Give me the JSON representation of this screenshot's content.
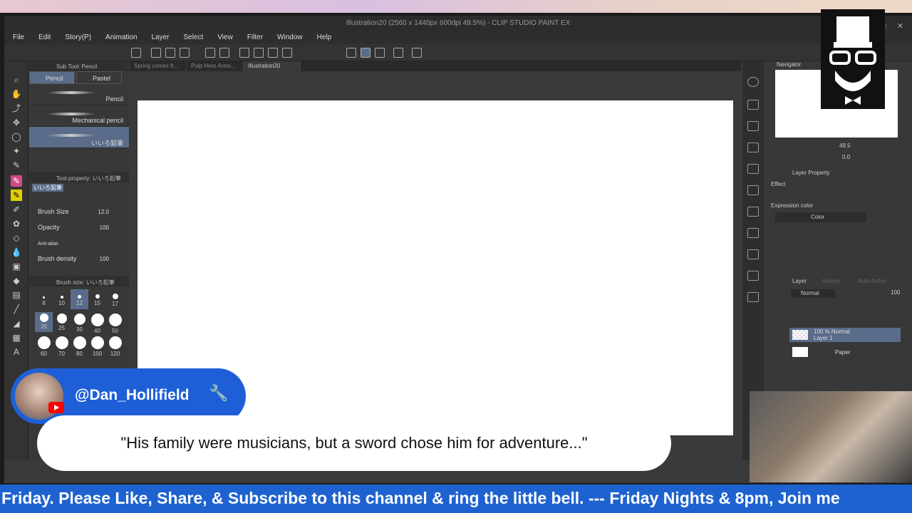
{
  "window": {
    "title": "Illustration20 (2560 x 1440px 600dpi 49.5%) - CLIP STUDIO PAINT EX",
    "controls": "□ ✕"
  },
  "menu": [
    "File",
    "Edit",
    "Story(P)",
    "Animation",
    "Layer",
    "Select",
    "View",
    "Filter",
    "Window",
    "Help"
  ],
  "doc_tabs": [
    "Spring comes fr...",
    "Pulp Hero Arms...",
    "Illustration20"
  ],
  "sub_tool": {
    "header": "Sub Tool: Pencil",
    "tab_pencil": "Pencil",
    "tab_pastel": "Pastel",
    "brushes": [
      "Pencil",
      "Mechanical pencil",
      "いいろ鉛筆"
    ]
  },
  "tool_property": {
    "header": "Tool property: いいろ鉛筆",
    "brush_name": "いいろ鉛筆",
    "brush_size_label": "Brush Size",
    "brush_size_val": "12.0",
    "opacity_label": "Opacity",
    "opacity_val": "100",
    "antialias_label": "Anti-alias",
    "density_label": "Brush density",
    "density_val": "100"
  },
  "brush_size_panel": {
    "header": "Brush size: いいろ鉛筆",
    "sizes": [
      "8",
      "10",
      "12",
      "15",
      "17",
      "20",
      "25",
      "30",
      "40",
      "50",
      "60",
      "70",
      "80",
      "100",
      "120"
    ]
  },
  "navigator": {
    "header": "Navigator",
    "zoom": "49.5",
    "rotate": "0.0"
  },
  "layer_property": {
    "header": "Layer Property",
    "effect": "Effect",
    "expression": "Expression color",
    "color": "Color"
  },
  "layer_panel": {
    "tab_layer": "Layer",
    "tab_history": "History",
    "tab_auto": "Auto Action",
    "blend": "Normal",
    "opacity": "100",
    "layers": [
      {
        "line1": "100 % Normal",
        "line2": "Layer 1"
      },
      {
        "line1": "Paper",
        "line2": ""
      }
    ]
  },
  "chat": {
    "username": "@Dan_Hollifield",
    "badge_icon": "wrench-icon",
    "message": "\"His family were musicians, but a sword chose him for adventure...\""
  },
  "ticker": "Friday. Please Like, Share, & Subscribe to this channel & ring the little bell. --- Friday Nights & 8pm, Join me"
}
